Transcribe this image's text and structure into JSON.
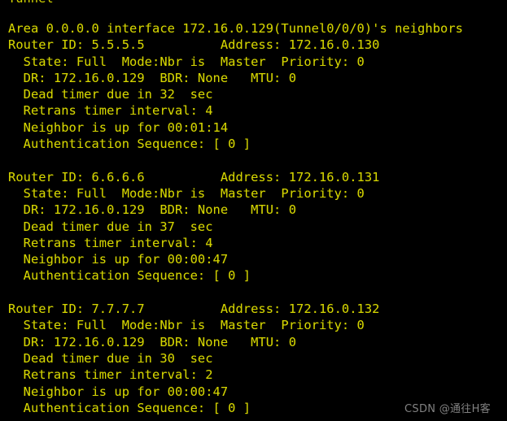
{
  "terminal": {
    "background_color": "#000000",
    "text_color": "#d4d400",
    "partial_top_line": "Tunnel",
    "lines": [
      "Area 0.0.0.0 interface 172.16.0.129(Tunnel0/0/0)'s neighbors",
      "Router ID: 5.5.5.5          Address: 172.16.0.130",
      "  State: Full  Mode:Nbr is  Master  Priority: 0",
      "  DR: 172.16.0.129  BDR: None   MTU: 0",
      "  Dead timer due in 32  sec",
      "  Retrans timer interval: 4",
      "  Neighbor is up for 00:01:14",
      "  Authentication Sequence: [ 0 ]",
      "",
      "Router ID: 6.6.6.6          Address: 172.16.0.131",
      "  State: Full  Mode:Nbr is  Master  Priority: 0",
      "  DR: 172.16.0.129  BDR: None   MTU: 0",
      "  Dead timer due in 37  sec",
      "  Retrans timer interval: 4",
      "  Neighbor is up for 00:00:47",
      "  Authentication Sequence: [ 0 ]",
      "",
      "Router ID: 7.7.7.7          Address: 172.16.0.132",
      "  State: Full  Mode:Nbr is  Master  Priority: 0",
      "  DR: 172.16.0.129  BDR: None   MTU: 0",
      "  Dead timer due in 30  sec",
      "  Retrans timer interval: 2",
      "  Neighbor is up for 00:00:47",
      "  Authentication Sequence: [ 0 ]"
    ]
  },
  "ospf": {
    "area": "0.0.0.0",
    "interface_address": "172.16.0.129",
    "interface_name": "Tunnel0/0/0",
    "neighbors": [
      {
        "router_id": "5.5.5.5",
        "address": "172.16.0.130",
        "state": "Full",
        "mode": "Nbr is  Master",
        "priority": "0",
        "dr": "172.16.0.129",
        "bdr": "None",
        "mtu": "0",
        "dead_timer_sec": "32",
        "retrans_timer_interval": "4",
        "neighbor_up_for": "00:01:14",
        "authentication_sequence": "[ 0 ]"
      },
      {
        "router_id": "6.6.6.6",
        "address": "172.16.0.131",
        "state": "Full",
        "mode": "Nbr is  Master",
        "priority": "0",
        "dr": "172.16.0.129",
        "bdr": "None",
        "mtu": "0",
        "dead_timer_sec": "37",
        "retrans_timer_interval": "4",
        "neighbor_up_for": "00:00:47",
        "authentication_sequence": "[ 0 ]"
      },
      {
        "router_id": "7.7.7.7",
        "address": "172.16.0.132",
        "state": "Full",
        "mode": "Nbr is  Master",
        "priority": "0",
        "dr": "172.16.0.129",
        "bdr": "None",
        "mtu": "0",
        "dead_timer_sec": "30",
        "retrans_timer_interval": "2",
        "neighbor_up_for": "00:00:47",
        "authentication_sequence": "[ 0 ]"
      }
    ]
  },
  "watermark": {
    "text": "CSDN @通往H客",
    "color": "#8d8d8d"
  }
}
